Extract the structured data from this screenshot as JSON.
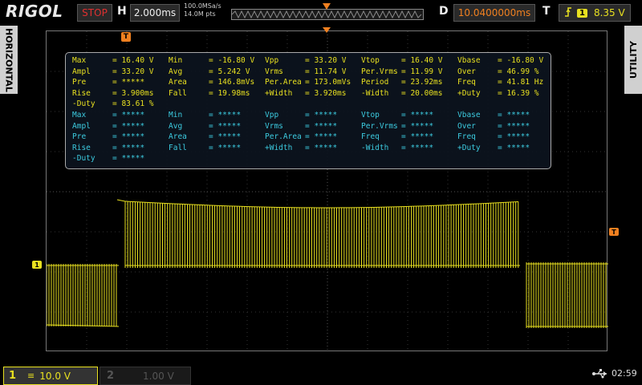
{
  "header": {
    "brand": "RIGOL",
    "run_state": "STOP",
    "h_label": "H",
    "timebase": "2.000ms",
    "sample_rate": "100.0MSa/s",
    "mem_depth": "14.0M pts",
    "d_label": "D",
    "delay": "10.0400000ms",
    "t_label": "T",
    "trigger_edge_icon": "rising-edge-icon",
    "trigger_channel": "1",
    "trigger_level": "8.35 V"
  },
  "side_tabs": {
    "left": "HORIZONTAL",
    "right": "UTILITY"
  },
  "markers": {
    "trigger_pos": "T",
    "trigger_level": "T",
    "channel": "1"
  },
  "measurements": {
    "ch1": [
      [
        [
          "Max",
          "= 16.40 V"
        ],
        [
          "Min",
          "= -16.80 V"
        ],
        [
          "Vpp",
          "= 33.20 V"
        ],
        [
          "Vtop",
          "= 16.40 V"
        ],
        [
          "Vbase",
          "= -16.80 V"
        ]
      ],
      [
        [
          "Ampl",
          "= 33.20 V"
        ],
        [
          "Avg",
          "= 5.242 V"
        ],
        [
          "Vrms",
          "= 11.74 V"
        ],
        [
          "Per.Vrms",
          "= 11.99 V"
        ],
        [
          "Over",
          "= 46.99 %"
        ]
      ],
      [
        [
          "Pre",
          "= *****"
        ],
        [
          "Area",
          "= 146.8mVs"
        ],
        [
          "Per.Area",
          "= 173.0mVs"
        ],
        [
          "Period",
          "= 23.92ms"
        ],
        [
          "Freq",
          "= 41.81 Hz"
        ]
      ],
      [
        [
          "Rise",
          "= 3.900ms"
        ],
        [
          "Fall",
          "= 19.98ms"
        ],
        [
          "+Width",
          "= 3.920ms"
        ],
        [
          "-Width",
          "= 20.00ms"
        ],
        [
          "+Duty",
          "= 16.39 %"
        ]
      ],
      [
        [
          "-Duty",
          "= 83.61 %"
        ]
      ]
    ],
    "ch2": [
      [
        [
          "Max",
          "= *****"
        ],
        [
          "Min",
          "= *****"
        ],
        [
          "Vpp",
          "= *****"
        ],
        [
          "Vtop",
          "= *****"
        ],
        [
          "Vbase",
          "= *****"
        ]
      ],
      [
        [
          "Ampl",
          "= *****"
        ],
        [
          "Avg",
          "= *****"
        ],
        [
          "Vrms",
          "= *****"
        ],
        [
          "Per.Vrms",
          "= *****"
        ],
        [
          "Over",
          "= *****"
        ]
      ],
      [
        [
          "Pre",
          "= *****"
        ],
        [
          "Area",
          "= *****"
        ],
        [
          "Per.Area",
          "= *****"
        ],
        [
          "Freq",
          "= *****"
        ],
        [
          "Freq2",
          "= *****"
        ]
      ],
      [
        [
          "Rise",
          "= *****"
        ],
        [
          "Fall",
          "= *****"
        ],
        [
          "+Width",
          "= *****"
        ],
        [
          "-Width",
          "= *****"
        ],
        [
          "+Duty",
          "= *****"
        ]
      ],
      [
        [
          "-Duty",
          "= *****"
        ]
      ]
    ]
  },
  "footer": {
    "ch1_num": "1",
    "ch1_coupling": "≡",
    "ch1_scale": "10.0 V",
    "ch2_num": "2",
    "ch2_scale": "1.00 V",
    "usb_icon": "usb-icon",
    "clock": "02:59"
  },
  "colors": {
    "ch1": "#e8e020",
    "ch2": "#3ccbe0",
    "trigger": "#f08020"
  }
}
